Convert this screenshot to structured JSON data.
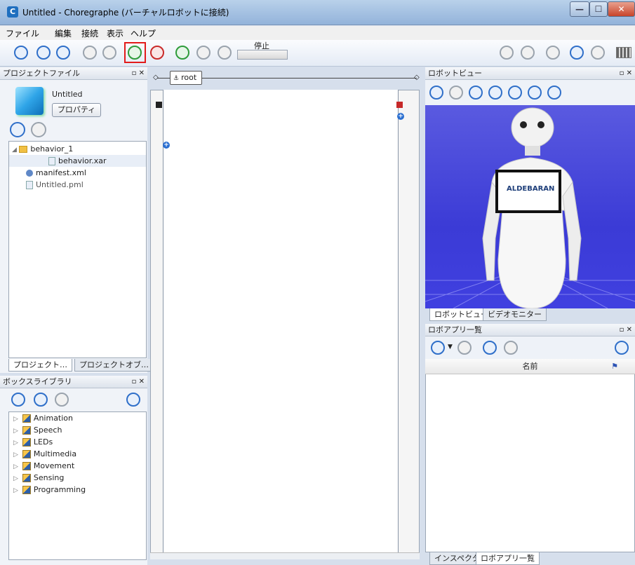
{
  "window": {
    "title": "Untitled - Choregraphe (バーチャルロボットに接続)",
    "app_icon": "C"
  },
  "menu": [
    "ファイル",
    "編集",
    "接続",
    "表示",
    "ヘルプ"
  ],
  "toolbar": {
    "stop_label": "停止",
    "icons": [
      "new-icon",
      "open-icon",
      "save-icon",
      "undo-icon",
      "redo-icon",
      "connect-icon",
      "disconnect-icon",
      "play-icon",
      "stop-icon",
      "warning-icon",
      "volume-icon",
      "animation-mode-icon",
      "heart-icon",
      "sleep-icon",
      "settings-icon",
      "battery-icon"
    ]
  },
  "project_panel": {
    "title": "プロジェクトファイル",
    "project_name": "Untitled",
    "properties_button": "プロパティ",
    "tree": [
      {
        "label": "behavior_1",
        "type": "folder"
      },
      {
        "label": "behavior.xar",
        "type": "file",
        "selected": true
      },
      {
        "label": "manifest.xml",
        "type": "manifest"
      },
      {
        "label": "Untitled.pml",
        "type": "pml"
      }
    ],
    "tabs": [
      "プロジェクト…",
      "プロジェクトオブ…"
    ]
  },
  "box_library": {
    "title": "ボックスライブラリ",
    "items": [
      "Animation",
      "Speech",
      "LEDs",
      "Multimedia",
      "Movement",
      "Sensing",
      "Programming"
    ]
  },
  "flow": {
    "root_label": "root"
  },
  "robot_view": {
    "title": "ロボットビュー",
    "logo_text": "ALDEBARAN",
    "tabs": [
      "ロボットビュー",
      "ビデオモニター"
    ]
  },
  "app_panel": {
    "title": "ロボアプリ一覧",
    "column_header": "名前",
    "tabs": [
      "インスペクタ",
      "ロボアプリ一覧"
    ]
  }
}
